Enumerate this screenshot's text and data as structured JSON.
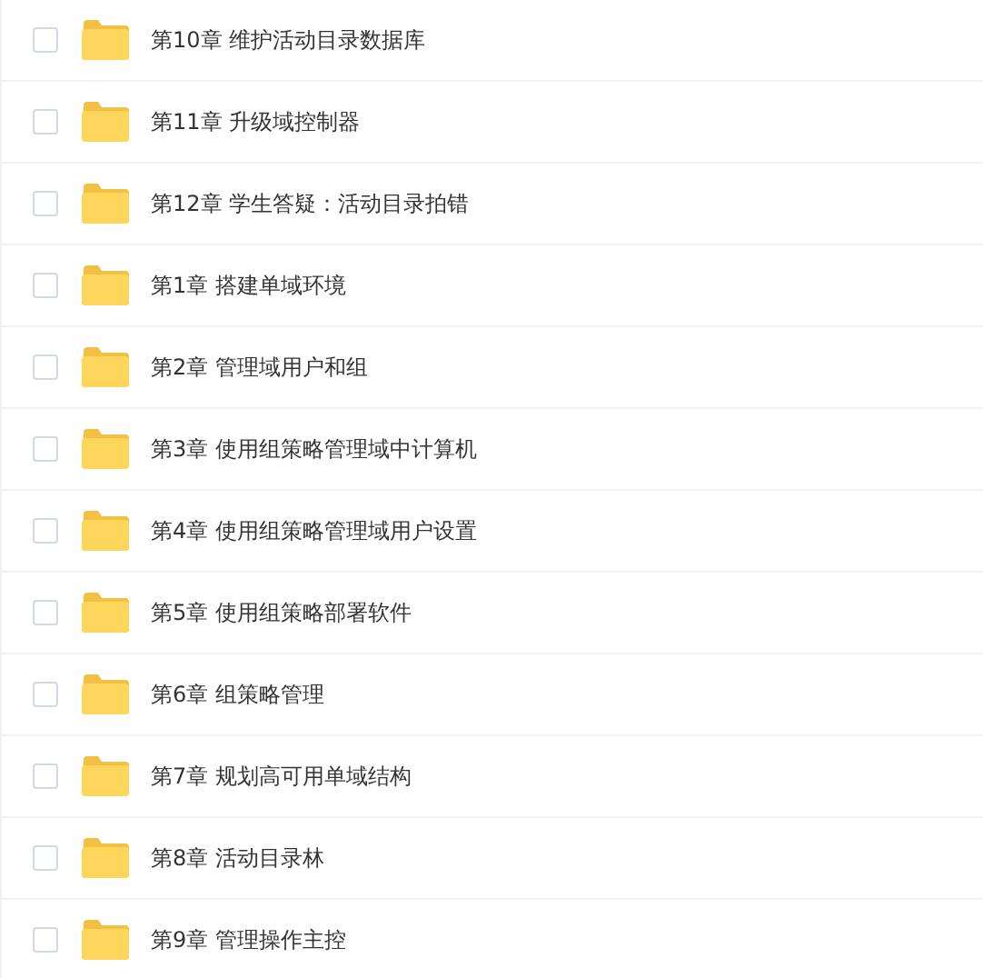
{
  "folders": [
    {
      "name": "第10章 维护活动目录数据库",
      "checked": false
    },
    {
      "name": "第11章 升级域控制器",
      "checked": false
    },
    {
      "name": "第12章 学生答疑：活动目录拍错",
      "checked": false
    },
    {
      "name": "第1章 搭建单域环境",
      "checked": false
    },
    {
      "name": "第2章 管理域用户和组",
      "checked": false
    },
    {
      "name": "第3章 使用组策略管理域中计算机",
      "checked": false
    },
    {
      "name": "第4章 使用组策略管理域用户设置",
      "checked": false
    },
    {
      "name": "第5章 使用组策略部署软件",
      "checked": false
    },
    {
      "name": "第6章 组策略管理",
      "checked": false
    },
    {
      "name": "第7章 规划高可用单域结构",
      "checked": false
    },
    {
      "name": "第8章 活动目录林",
      "checked": false
    },
    {
      "name": "第9章 管理操作主控",
      "checked": false
    }
  ]
}
